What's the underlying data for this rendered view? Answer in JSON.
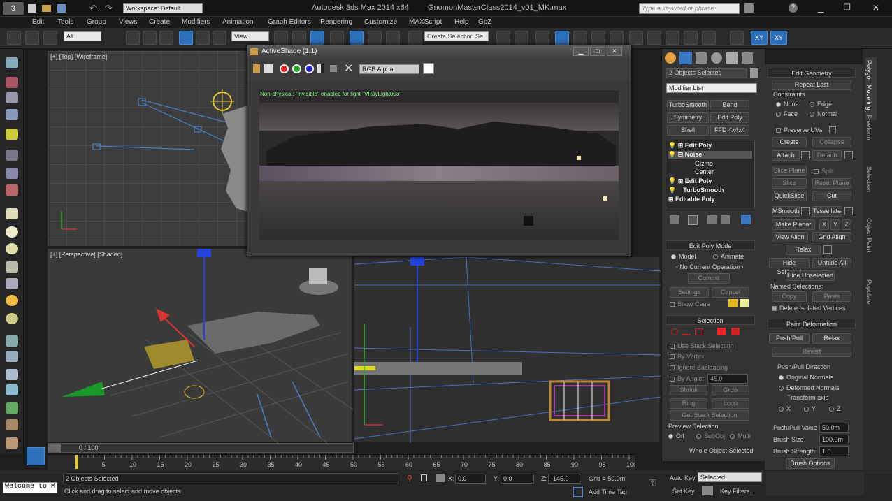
{
  "titlebar": {
    "workspace": "Workspace: Default",
    "app_title": "Autodesk 3ds Max  2014 x64",
    "file_title": "GnomonMasterClass2014_v01_MK.max",
    "search_placeholder": "Type a keyword or phrase"
  },
  "menu": [
    "Edit",
    "Tools",
    "Group",
    "Views",
    "Create",
    "Modifiers",
    "Animation",
    "Graph Editors",
    "Rendering",
    "Customize",
    "MAXScript",
    "Help",
    "GoZ"
  ],
  "toolbar": {
    "filter_value": "All",
    "refcoord_value": "View",
    "selection_set_placeholder": "Create Selection Se",
    "xy_label": "XY",
    "xy2_label": "XY"
  },
  "viewports": {
    "top_label": "[+] [Top] [Wireframe]",
    "persp_label": "[+] [Perspective] [Shaded]"
  },
  "activeshade": {
    "title": "ActiveShade (1:1)",
    "channel_value": "RGB Alpha",
    "message": "Non-physical: \"invisible\" enabled for light \"VRayLight003\""
  },
  "command_panel": {
    "selection_name": "2 Objects Selected",
    "modifier_list": "Modifier List",
    "modifier_buttons": [
      "TurboSmooth",
      "Bend",
      "Symmetry",
      "Edit Poly",
      "Shell",
      "FFD 4x4x4"
    ],
    "stack": {
      "edit_poly_1": "Edit Poly",
      "noise": "Noise",
      "gizmo": "Gizmo",
      "center": "Center",
      "edit_poly_2": "Edit Poly",
      "turbosmooth": "TurboSmooth",
      "editable_poly": "Editable Poly"
    },
    "edit_poly_mode": {
      "header": "Edit Poly Mode",
      "model": "Model",
      "animate": "Animate",
      "no_op": "<No Current Operation>",
      "commit": "Commit",
      "settings": "Settings",
      "cancel": "Cancel",
      "show_cage": "Show Cage"
    },
    "selection": {
      "header": "Selection",
      "use_stack": "Use Stack Selection",
      "by_vertex": "By Vertex",
      "ignore_backfacing": "Ignore Backfacing",
      "by_angle": "By Angle:",
      "by_angle_value": "45.0",
      "shrink": "Shrink",
      "grow": "Grow",
      "ring": "Ring",
      "loop": "Loop",
      "get_stack": "Get Stack Selection",
      "preview": "Preview Selection",
      "off": "Off",
      "subobj": "SubObj",
      "multi": "Multi",
      "whole": "Whole Object Selected"
    }
  },
  "ribbon": {
    "edit_geometry": "Edit Geometry",
    "repeat_last": "Repeat Last",
    "constraints": "Constraints",
    "none": "None",
    "edge": "Edge",
    "face": "Face",
    "normal": "Normal",
    "preserve_uvs": "Preserve UVs",
    "create": "Create",
    "collapse": "Collapse",
    "attach": "Attach",
    "detach": "Detach",
    "slice_plane": "Slice Plane",
    "split": "Split",
    "slice": "Slice",
    "reset_plane": "Reset Plane",
    "quickslice": "QuickSlice",
    "cut": "Cut",
    "msmooth": "MSmooth",
    "tessellate": "Tessellate",
    "make_planar": "Make Planar",
    "x": "X",
    "y": "Y",
    "z": "Z",
    "view_align": "View Align",
    "grid_align": "Grid Align",
    "relax": "Relax",
    "hide_selected": "Hide Selected",
    "unhide_all": "Unhide All",
    "hide_unselected": "Hide Unselected",
    "named_selections": "Named Selections:",
    "copy": "Copy",
    "paste": "Paste",
    "delete_isolated": "Delete Isolated Vertices",
    "paint_deformation": "Paint Deformation",
    "push_pull": "Push/Pull",
    "relax2": "Relax",
    "revert": "Revert",
    "push_pull_dir": "Push/Pull Direction",
    "original_normals": "Original Normals",
    "deformed_normals": "Deformed Normals",
    "transform_axis": "Transform axis",
    "ax_x": "X",
    "ax_y": "Y",
    "ax_z": "Z",
    "pp_value_label": "Push/Pull Value",
    "pp_value": "50.0m",
    "brush_size_label": "Brush Size",
    "brush_size": "100.0m",
    "brush_strength_label": "Brush Strength",
    "brush_strength": "1.0",
    "brush_options": "Brush Options"
  },
  "vtabs": [
    "Polygon Modeling",
    "Freeform",
    "Selection",
    "Object Paint",
    "Populate"
  ],
  "timeline": {
    "frame_counter": "0 / 100",
    "ticks": [
      "5",
      "10",
      "15",
      "20",
      "25",
      "30",
      "35",
      "40",
      "45",
      "50",
      "55",
      "60",
      "65",
      "70",
      "75",
      "80",
      "85",
      "90",
      "95",
      "100"
    ]
  },
  "status": {
    "maxscript": "Welcome to M",
    "selected": "2 Objects Selected",
    "prompt": "Click and drag to select and move objects",
    "x_label": "X:",
    "x_value": "0.0",
    "y_label": "Y:",
    "y_value": "0.0",
    "z_label": "Z:",
    "z_value": "-145.0",
    "grid": "Grid = 50.0m",
    "add_time_tag": "Add Time Tag",
    "auto_key": "Auto Key",
    "set_key": "Set Key",
    "key_mode": "Selected",
    "key_filters": "Key Filters..."
  }
}
